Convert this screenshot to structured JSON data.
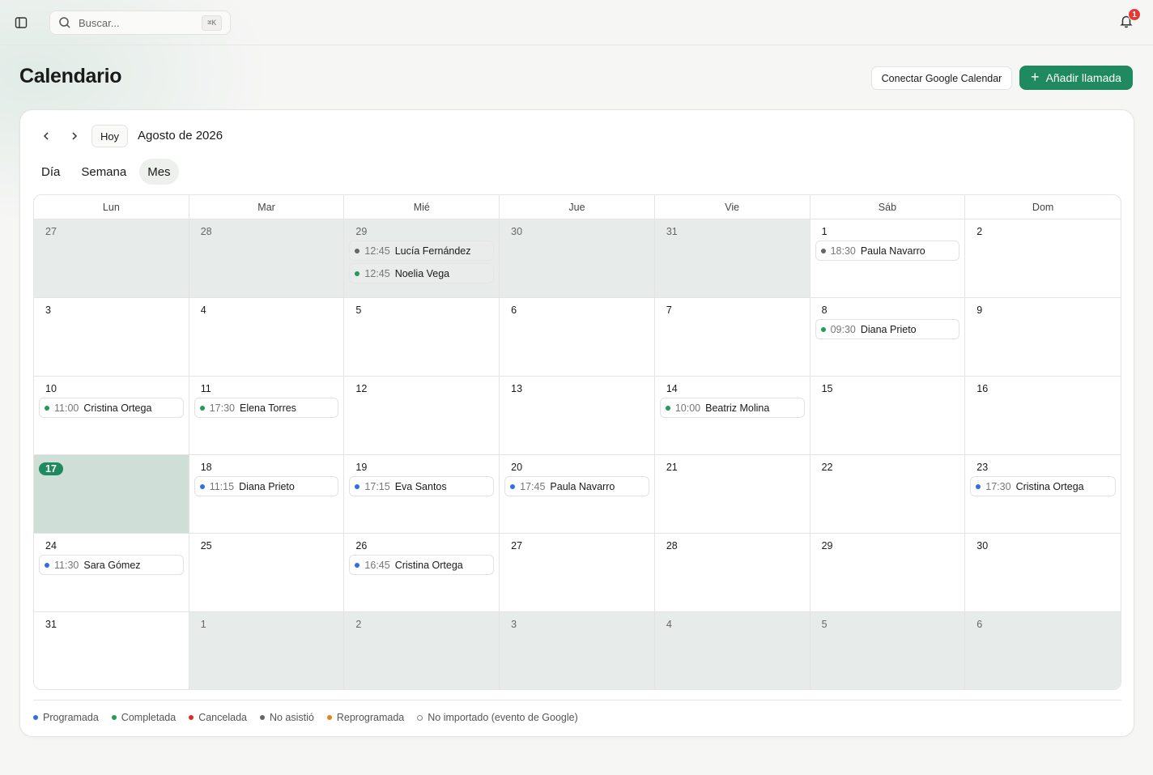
{
  "topbar": {
    "search_placeholder": "Buscar...",
    "search_shortcut": "⌘K",
    "notification_count": "1"
  },
  "header": {
    "title": "Calendario",
    "google_button": "Conectar Google Calendar",
    "add_button": "Añadir llamada"
  },
  "calendar": {
    "today_button": "Hoy",
    "month_label": "Agosto de 2026",
    "views": [
      "Día",
      "Semana",
      "Mes"
    ],
    "active_view": "Mes",
    "weekdays": [
      "Lun",
      "Mar",
      "Mié",
      "Jue",
      "Vie",
      "Sáb",
      "Dom"
    ],
    "days": [
      {
        "num": "27",
        "out": true,
        "events": []
      },
      {
        "num": "28",
        "out": true,
        "events": []
      },
      {
        "num": "29",
        "out": true,
        "events": [
          {
            "time": "12:45",
            "name": "Lucía Fernández",
            "status": "noshow"
          },
          {
            "time": "12:45",
            "name": "Noelia Vega",
            "status": "completed"
          }
        ]
      },
      {
        "num": "30",
        "out": true,
        "events": []
      },
      {
        "num": "31",
        "out": true,
        "events": []
      },
      {
        "num": "1",
        "events": [
          {
            "time": "18:30",
            "name": "Paula Navarro",
            "status": "noshow"
          }
        ]
      },
      {
        "num": "2",
        "events": []
      },
      {
        "num": "3",
        "events": []
      },
      {
        "num": "4",
        "events": []
      },
      {
        "num": "5",
        "events": []
      },
      {
        "num": "6",
        "events": []
      },
      {
        "num": "7",
        "events": []
      },
      {
        "num": "8",
        "events": [
          {
            "time": "09:30",
            "name": "Diana Prieto",
            "status": "completed"
          }
        ]
      },
      {
        "num": "9",
        "events": []
      },
      {
        "num": "10",
        "events": [
          {
            "time": "11:00",
            "name": "Cristina Ortega",
            "status": "completed"
          }
        ]
      },
      {
        "num": "11",
        "events": [
          {
            "time": "17:30",
            "name": "Elena Torres",
            "status": "completed"
          }
        ]
      },
      {
        "num": "12",
        "events": []
      },
      {
        "num": "13",
        "events": []
      },
      {
        "num": "14",
        "events": [
          {
            "time": "10:00",
            "name": "Beatriz Molina",
            "status": "completed"
          }
        ]
      },
      {
        "num": "15",
        "events": []
      },
      {
        "num": "16",
        "events": []
      },
      {
        "num": "17",
        "today": true,
        "events": []
      },
      {
        "num": "18",
        "events": [
          {
            "time": "11:15",
            "name": "Diana Prieto",
            "status": "scheduled"
          }
        ]
      },
      {
        "num": "19",
        "events": [
          {
            "time": "17:15",
            "name": "Eva Santos",
            "status": "scheduled"
          }
        ]
      },
      {
        "num": "20",
        "events": [
          {
            "time": "17:45",
            "name": "Paula Navarro",
            "status": "scheduled"
          }
        ]
      },
      {
        "num": "21",
        "events": []
      },
      {
        "num": "22",
        "events": []
      },
      {
        "num": "23",
        "events": [
          {
            "time": "17:30",
            "name": "Cristina Ortega",
            "status": "scheduled"
          }
        ]
      },
      {
        "num": "24",
        "events": [
          {
            "time": "11:30",
            "name": "Sara Gómez",
            "status": "scheduled"
          }
        ]
      },
      {
        "num": "25",
        "events": []
      },
      {
        "num": "26",
        "events": [
          {
            "time": "16:45",
            "name": "Cristina Ortega",
            "status": "scheduled"
          }
        ]
      },
      {
        "num": "27",
        "events": []
      },
      {
        "num": "28",
        "events": []
      },
      {
        "num": "29",
        "events": []
      },
      {
        "num": "30",
        "events": []
      },
      {
        "num": "31",
        "events": []
      },
      {
        "num": "1",
        "out": true,
        "events": []
      },
      {
        "num": "2",
        "out": true,
        "events": []
      },
      {
        "num": "3",
        "out": true,
        "events": []
      },
      {
        "num": "4",
        "out": true,
        "events": []
      },
      {
        "num": "5",
        "out": true,
        "events": []
      },
      {
        "num": "6",
        "out": true,
        "events": []
      }
    ]
  },
  "status_colors": {
    "scheduled": "#2f6fe0",
    "completed": "#1f9d55",
    "cancelled": "#d93025",
    "noshow": "#666666",
    "rescheduled": "#e0821f",
    "not_imported": "#888888"
  },
  "legend": [
    {
      "key": "scheduled",
      "label": "Programada"
    },
    {
      "key": "completed",
      "label": "Completada"
    },
    {
      "key": "cancelled",
      "label": "Cancelada"
    },
    {
      "key": "noshow",
      "label": "No asistió"
    },
    {
      "key": "rescheduled",
      "label": "Reprogramada"
    },
    {
      "key": "not_imported",
      "label": "No importado (evento de Google)",
      "hollow": true
    }
  ]
}
